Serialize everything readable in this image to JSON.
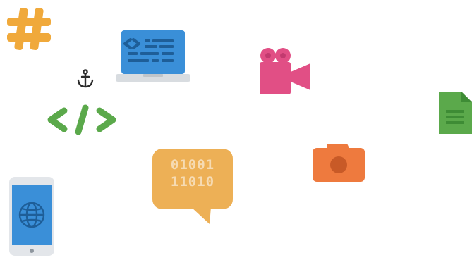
{
  "icons": [
    {
      "name": "hashtag-icon",
      "color": "#F0A93B"
    },
    {
      "name": "laptop-code-icon",
      "color": "#3A8FD8"
    },
    {
      "name": "anchor-icon",
      "color": "#2C2C2C"
    },
    {
      "name": "code-tag-icon",
      "color": "#5BA94B"
    },
    {
      "name": "video-camera-icon",
      "color": "#E14F85"
    },
    {
      "name": "document-icon",
      "color": "#5BA94B"
    },
    {
      "name": "camera-icon",
      "color": "#EE7A3E"
    },
    {
      "name": "binary-chat-bubble-icon",
      "color": "#EDB056"
    },
    {
      "name": "smartphone-globe-icon",
      "color": "#3A8FD8"
    }
  ],
  "bubble": {
    "line1": "01001",
    "line2": "11010"
  }
}
